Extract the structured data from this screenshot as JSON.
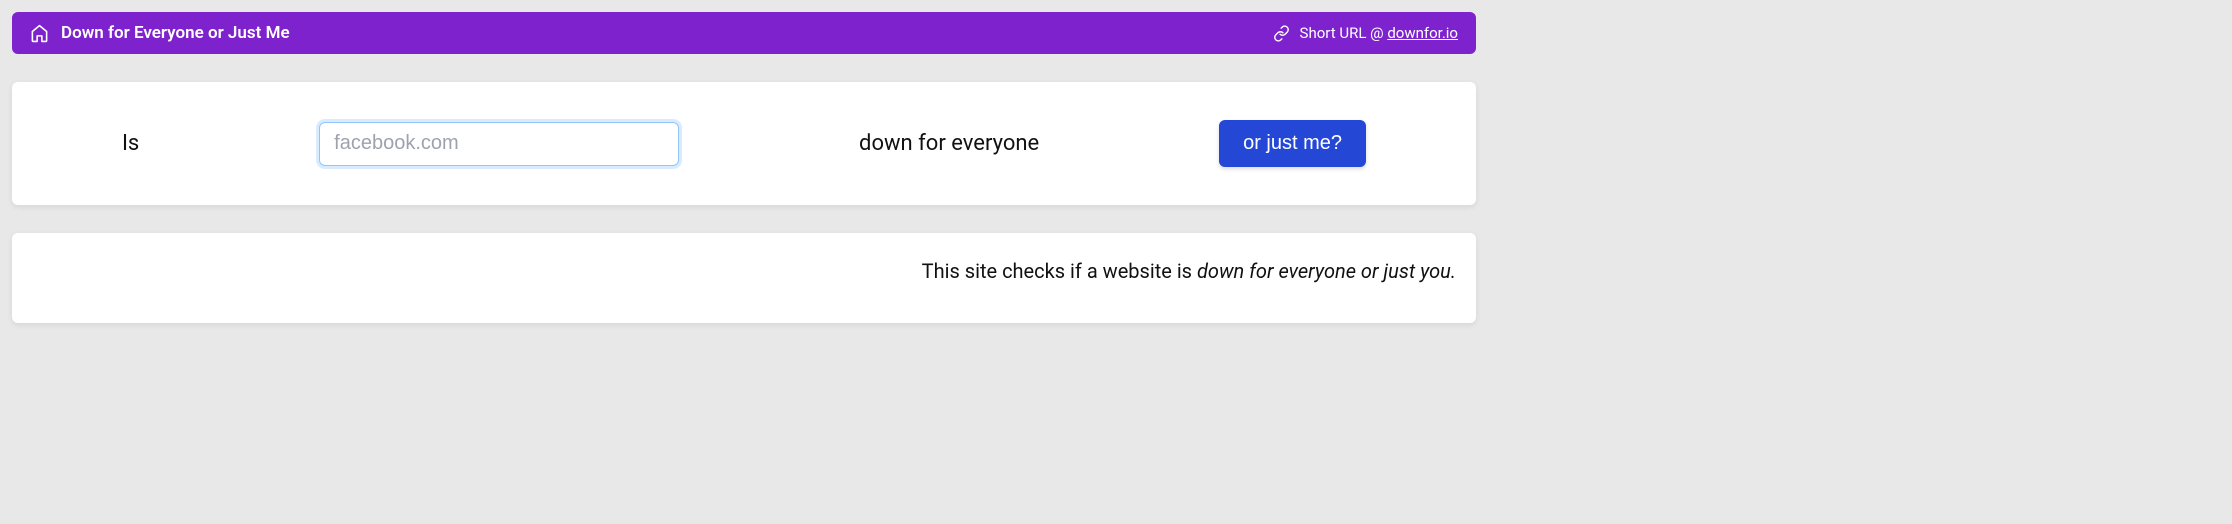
{
  "header": {
    "title": "Down for Everyone or Just Me",
    "short_url_prefix": "Short URL @ ",
    "short_url_domain": "downfor.io"
  },
  "form": {
    "prefix_text": "Is",
    "placeholder": "facebook.com",
    "input_value": "",
    "middle_text": "down for everyone",
    "button_label": "or just me?"
  },
  "info": {
    "prefix": "This site checks if a website is ",
    "italic": "down for everyone or just you."
  }
}
